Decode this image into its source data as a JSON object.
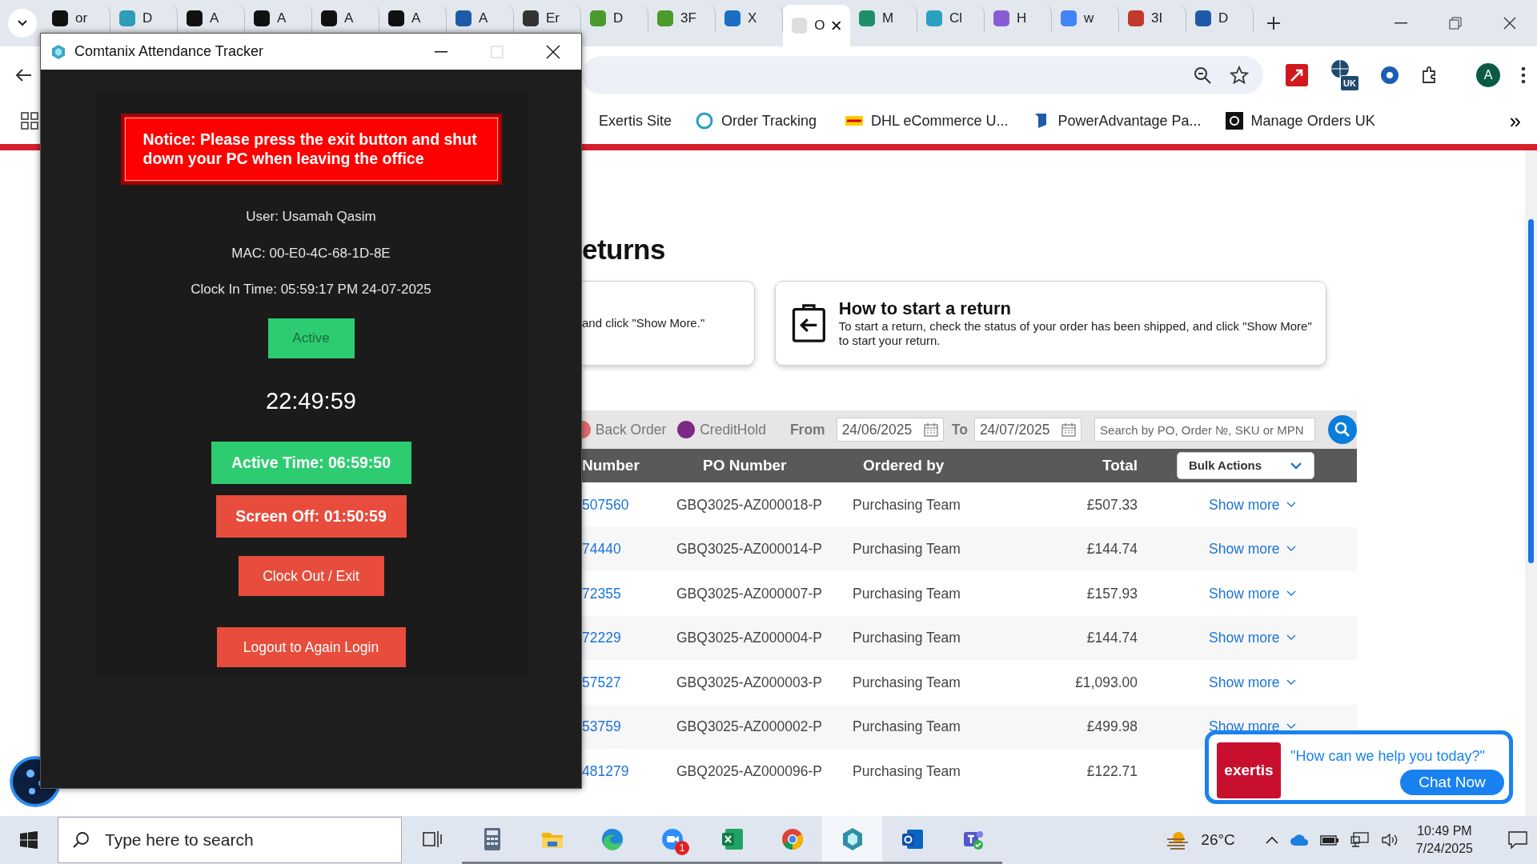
{
  "browser": {
    "tabs": [
      {
        "label": "or",
        "selected": false
      },
      {
        "label": "D",
        "selected": false
      },
      {
        "label": "A",
        "selected": false
      },
      {
        "label": "A",
        "selected": false
      },
      {
        "label": "A",
        "selected": false
      },
      {
        "label": "A",
        "selected": false
      },
      {
        "label": "A",
        "selected": false
      },
      {
        "label": "Er",
        "selected": false
      },
      {
        "label": "D",
        "selected": false
      },
      {
        "label": "3F",
        "selected": false
      },
      {
        "label": "X",
        "selected": false
      },
      {
        "label": "O",
        "selected": true
      },
      {
        "label": "M",
        "selected": false
      },
      {
        "label": "Cl",
        "selected": false
      },
      {
        "label": "H",
        "selected": false
      },
      {
        "label": "w",
        "selected": false
      },
      {
        "label": "3I",
        "selected": false
      },
      {
        "label": "D",
        "selected": false
      }
    ],
    "ext_badge": "UK",
    "profile_initial": "A",
    "bookmarks": [
      {
        "label": "Exertis Site"
      },
      {
        "label": "Order Tracking"
      },
      {
        "label": "DHL eCommerce U..."
      },
      {
        "label": "PowerAdvantage Pa..."
      },
      {
        "label": "Manage Orders UK"
      }
    ],
    "more": "»"
  },
  "tracker": {
    "title": "Comtanix Attendance Tracker",
    "notice": "Notice: Please press the exit button and shut down your PC when leaving the office",
    "user": "User: Usamah Qasim",
    "mac": "MAC: 00-E0-4C-68-1D-8E",
    "clock_in": "Clock In Time: 05:59:17 PM 24-07-2025",
    "status": "Active",
    "clock": "22:49:59",
    "active_time": "Active Time: 06:59:50",
    "screen_off": "Screen Off: 01:50:59",
    "buttons": [
      "Clock Out / Exit",
      "Logout to Again Login"
    ]
  },
  "page": {
    "heading": "eturns",
    "cards": [
      {
        "text": "and click \"Show More.\""
      },
      {
        "title": "How to start a return",
        "text": "To start a return, check the status of your order has been shipped, and click \"Show More\" to start your return."
      }
    ],
    "legend": [
      {
        "label": "Back Order",
        "color": "#e06c6c"
      },
      {
        "label": "CreditHold",
        "color": "#7d2a86"
      }
    ],
    "from_label": "From",
    "from": "24/06/2025",
    "to_label": "To",
    "to": "24/07/2025",
    "search_placeholder": "Search by PO, Order №, SKU or MPN",
    "columns": [
      "Number",
      "PO Number",
      "Ordered by",
      "Total"
    ],
    "bulk_actions": "Bulk Actions",
    "rows": [
      {
        "number": "507560",
        "po": "GBQ3025-AZ000018-P",
        "ordered_by": "Purchasing Team",
        "total": "£507.33",
        "action": "Show more"
      },
      {
        "number": "74440",
        "po": "GBQ3025-AZ000014-P",
        "ordered_by": "Purchasing Team",
        "total": "£144.74",
        "action": "Show more"
      },
      {
        "number": "72355",
        "po": "GBQ3025-AZ000007-P",
        "ordered_by": "Purchasing Team",
        "total": "£157.93",
        "action": "Show more"
      },
      {
        "number": "72229",
        "po": "GBQ3025-AZ000004-P",
        "ordered_by": "Purchasing Team",
        "total": "£144.74",
        "action": "Show more"
      },
      {
        "number": "57527",
        "po": "GBQ3025-AZ000003-P",
        "ordered_by": "Purchasing Team",
        "total": "£1,093.00",
        "action": "Show more"
      },
      {
        "number": "53759",
        "po": "GBQ3025-AZ000002-P",
        "ordered_by": "Purchasing Team",
        "total": "£499.98",
        "action": "Show more"
      },
      {
        "number": "481279",
        "po": "GBQ2025-AZ000096-P",
        "ordered_by": "Purchasing Team",
        "total": "£122.71"
      }
    ]
  },
  "chat": {
    "brand": "exertis",
    "prompt": "\"How can we help you today?\"",
    "button": "Chat Now"
  },
  "taskbar": {
    "search_placeholder": "Type here to search",
    "zoom_badge": "1",
    "apps": [
      {
        "kind": "calculator",
        "running": true,
        "selected": false
      },
      {
        "kind": "folder",
        "running": true,
        "selected": false
      },
      {
        "kind": "edge",
        "running": true,
        "selected": false
      },
      {
        "kind": "zoom",
        "running": true,
        "selected": false
      },
      {
        "kind": "excel",
        "running": true,
        "selected": false
      },
      {
        "kind": "chrome",
        "running": true,
        "selected": false
      },
      {
        "kind": "tracker",
        "running": true,
        "selected": true
      },
      {
        "kind": "outlook",
        "running": true,
        "selected": false
      },
      {
        "kind": "teams",
        "running": true,
        "selected": false
      }
    ],
    "weather": "26°C",
    "time": "10:49 PM",
    "date": "7/24/2025"
  }
}
